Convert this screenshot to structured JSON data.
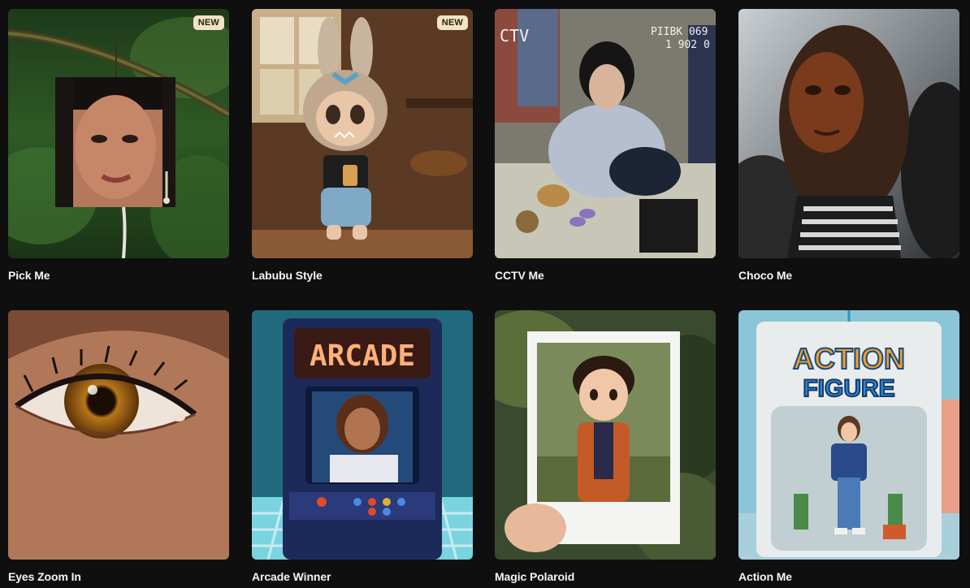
{
  "badge_colors": {
    "background": "#f2e3c3",
    "text": "#2a2115"
  },
  "cards": [
    {
      "title": "Pick Me",
      "badge": "NEW"
    },
    {
      "title": "Labubu Style",
      "badge": "NEW"
    },
    {
      "title": "CCTV Me",
      "overlay_left": "CTV",
      "overlay_right_1": "PIIBK 069",
      "overlay_right_2": "1 902 0"
    },
    {
      "title": "Choco Me"
    },
    {
      "title": "Eyes Zoom In"
    },
    {
      "title": "Arcade Winner",
      "marquee": "ARCADE"
    },
    {
      "title": "Magic Polaroid"
    },
    {
      "title": "Action Me",
      "box_text_1": "ACTION",
      "box_text_2": "FIGURE"
    }
  ]
}
